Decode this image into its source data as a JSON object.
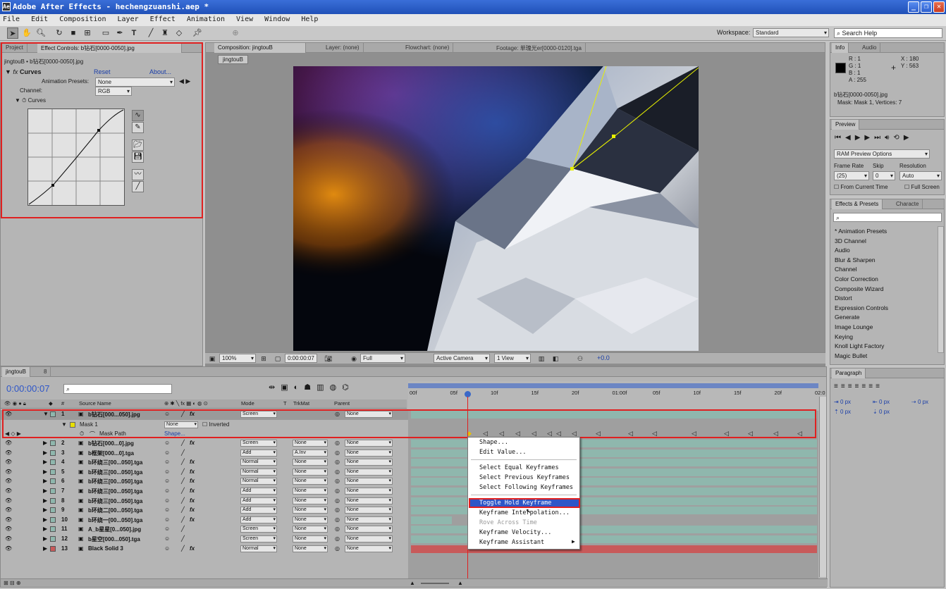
{
  "titlebar": {
    "title": "Adobe After Effects - hechengzuanshi.aep *",
    "app_icon": "Ae"
  },
  "menubar": {
    "items": [
      "File",
      "Edit",
      "Composition",
      "Layer",
      "Effect",
      "Animation",
      "View",
      "Window",
      "Help"
    ]
  },
  "toolbar": {
    "workspace_label": "Workspace:",
    "workspace_value": "Standard",
    "search_placeholder": "Search Help"
  },
  "project_panel": {
    "tabs": [
      "Project",
      "Effect Controls: b钻石[0000-0050].jpg"
    ],
    "breadcrumb": "jingtouB • b钻石[0000-0050].jpg",
    "effect_name": "Curves",
    "reset_label": "Reset",
    "about_label": "About...",
    "anim_presets_label": "Animation Presets:",
    "anim_presets_value": "None",
    "channel_label": "Channel:",
    "channel_value": "RGB",
    "curves_label": "Curves"
  },
  "comp_panel": {
    "tabs": [
      "Composition: jingtouB",
      "Layer: (none)",
      "Flowchart: (none)",
      "Footage: 单瑰光er[0000-0120].tga"
    ],
    "comp_button": "jingtouB",
    "bottom": {
      "zoom": "100%",
      "timecode": "0:00:00:07",
      "resolution": "Full",
      "camera": "Active Camera",
      "view": "1 View",
      "exposure": "+0.0"
    }
  },
  "info_panel": {
    "tabs": [
      "Info",
      "Audio"
    ],
    "r": "R : 1",
    "g": "G : 1",
    "b": "B : 1",
    "a": "A : 255",
    "x": "X : 180",
    "y": "Y : 563",
    "file": "b钻石[0000-0050].jpg",
    "mask": "Mask: Mask 1, Vertices: 7"
  },
  "preview_panel": {
    "tab": "Preview",
    "ram_options": "RAM Preview Options",
    "frame_rate_label": "Frame Rate",
    "skip_label": "Skip",
    "resolution_label": "Resolution",
    "frame_rate": "(25)",
    "skip": "0",
    "resolution": "Auto",
    "from_current": "From Current Time",
    "full_screen": "Full Screen"
  },
  "effects_panel": {
    "tabs": [
      "Effects & Presets",
      "Characte"
    ],
    "items": [
      "* Animation Presets",
      "3D Channel",
      "Audio",
      "Blur & Sharpen",
      "Channel",
      "Color Correction",
      "Composite Wizard",
      "Distort",
      "Expression Controls",
      "Generate",
      "Image Lounge",
      "Keying",
      "Knoll Light Factory",
      "Magic Bullet"
    ]
  },
  "paragraph_panel": {
    "tab": "Paragraph",
    "values": [
      "0 px",
      "0 px",
      "0 px",
      "0 px",
      "0 px"
    ]
  },
  "timeline": {
    "tabs": [
      "jingtouB",
      "8"
    ],
    "timecode": "0:00:00:07",
    "columns": {
      "source": "Source Name",
      "hash": "#",
      "mode": "Mode",
      "t": "T",
      "trkmat": "TrkMat",
      "parent": "Parent"
    },
    "ruler": [
      "00f",
      "05f",
      "10f",
      "15f",
      "20f",
      "01:00f",
      "05f",
      "10f",
      "15f",
      "20f",
      "02:0"
    ],
    "mask_label": "Mask 1",
    "mask_mode": "None",
    "mask_inverted": "Inverted",
    "mask_path_label": "Mask Path",
    "mask_path_value": "Shape...",
    "layers": [
      {
        "num": "1",
        "name": "b钻石[000...050].jpg",
        "mode": "Screen",
        "trkmat": "",
        "parent": "None",
        "fx": true,
        "color": "#8fb7ad"
      },
      {
        "num": "2",
        "name": "b钻石[000...0].jpg",
        "mode": "Screen",
        "trkmat": "None",
        "parent": "None",
        "fx": true,
        "color": "#8fb7ad"
      },
      {
        "num": "3",
        "name": "b框架[000...0].tga",
        "mode": "Add",
        "trkmat": "A.Inv",
        "parent": "None",
        "fx": false,
        "color": "#8fb7ad"
      },
      {
        "num": "4",
        "name": "b环绕三[00...050].tga",
        "mode": "Normal",
        "trkmat": "None",
        "parent": "None",
        "fx": true,
        "color": "#8fb7ad"
      },
      {
        "num": "5",
        "name": "b环绕三[00...050].tga",
        "mode": "Normal",
        "trkmat": "None",
        "parent": "None",
        "fx": true,
        "color": "#8fb7ad"
      },
      {
        "num": "6",
        "name": "b环绕三[00...050].tga",
        "mode": "Normal",
        "trkmat": "None",
        "parent": "None",
        "fx": true,
        "color": "#8fb7ad"
      },
      {
        "num": "7",
        "name": "b环绕三[00...050].tga",
        "mode": "Add",
        "trkmat": "None",
        "parent": "None",
        "fx": true,
        "color": "#8fb7ad"
      },
      {
        "num": "8",
        "name": "b环绕三[00...050].tga",
        "mode": "Add",
        "trkmat": "None",
        "parent": "None",
        "fx": true,
        "color": "#8fb7ad"
      },
      {
        "num": "9",
        "name": "b环绕二[00...050].tga",
        "mode": "Add",
        "trkmat": "None",
        "parent": "None",
        "fx": true,
        "color": "#8fb7ad"
      },
      {
        "num": "10",
        "name": "b环绕一[00...050].tga",
        "mode": "Add",
        "trkmat": "None",
        "parent": "None",
        "fx": true,
        "color": "#8fb7ad"
      },
      {
        "num": "11",
        "name": "A_b星星[0...050].jpg",
        "mode": "Screen",
        "trkmat": "None",
        "parent": "None",
        "fx": false,
        "color": "#8fb7ad"
      },
      {
        "num": "12",
        "name": "b星空[000...050].tga",
        "mode": "Screen",
        "trkmat": "None",
        "parent": "None",
        "fx": false,
        "color": "#8fb7ad"
      },
      {
        "num": "13",
        "name": "Black Solid 3",
        "mode": "Normal",
        "trkmat": "None",
        "parent": "None",
        "fx": true,
        "color": "#c85a5a"
      }
    ]
  },
  "context_menu": {
    "items": [
      {
        "label": "Shape...",
        "disabled": false
      },
      {
        "label": "Edit Value...",
        "disabled": false
      },
      {
        "label": "Select Equal Keyframes",
        "disabled": false
      },
      {
        "label": "Select Previous Keyframes",
        "disabled": false
      },
      {
        "label": "Select Following Keyframes",
        "disabled": false
      },
      {
        "label": "Toggle Hold Keyframe",
        "disabled": false
      },
      {
        "label": "Keyframe Interpolation...",
        "disabled": false
      },
      {
        "label": "Rove Across Time",
        "disabled": true
      },
      {
        "label": "Keyframe Velocity...",
        "disabled": false
      },
      {
        "label": "Keyframe Assistant",
        "disabled": false
      }
    ]
  },
  "colors": {
    "accent": "#2e56c8",
    "highlight_box": "#e02020",
    "current_time": "#e02020"
  }
}
